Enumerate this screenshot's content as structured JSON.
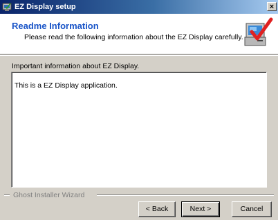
{
  "window": {
    "title": "EZ Display setup",
    "close_label": "×"
  },
  "header": {
    "title": "Readme Information",
    "subtitle": "Please read the following information about the EZ Display carefully."
  },
  "body": {
    "info_label": "Important information about EZ Display.",
    "readme_text": "This is a EZ Display application."
  },
  "footer": {
    "group_label": "Ghost Installer Wizard",
    "back_label": "< Back",
    "next_label": "Next >",
    "cancel_label": "Cancel"
  },
  "icons": {
    "title_icon": "setup-app-icon",
    "header_logo": "installer-computer-check-icon"
  },
  "colors": {
    "title_bar_start": "#0a246a",
    "title_bar_end": "#a6caf0",
    "header_title": "#1a55c8",
    "check_mark": "#e02020"
  }
}
